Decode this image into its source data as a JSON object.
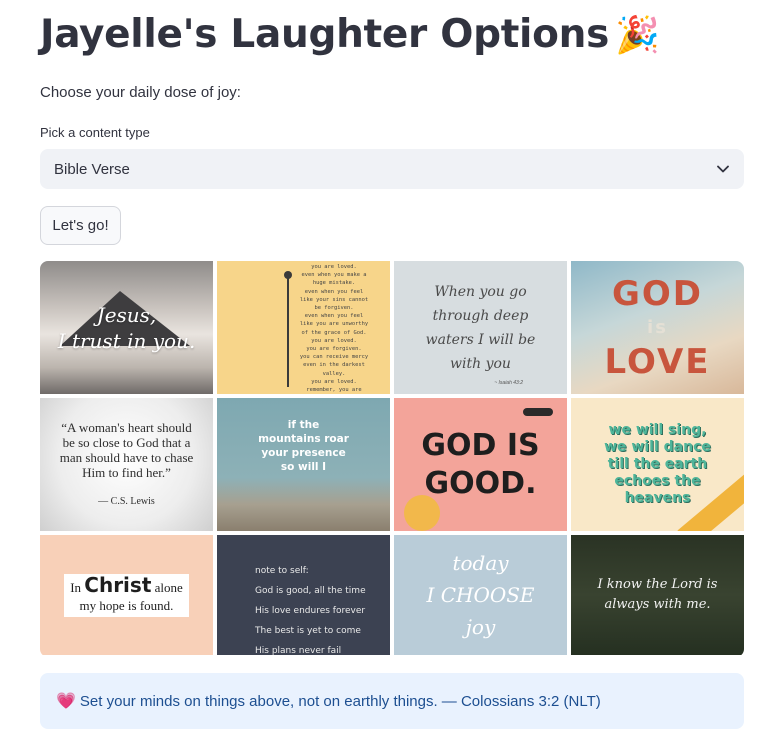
{
  "page": {
    "title": "Jayelle's Laughter Options",
    "title_emoji": "🎉",
    "subtitle": "Choose your daily dose of joy:"
  },
  "content_select": {
    "label": "Pick a content type",
    "value": "Bible Verse",
    "icon": "chevron-down-icon"
  },
  "go_button": {
    "label": "Let's go!"
  },
  "gallery": {
    "tiles": [
      {
        "text": "Jesus,\nI trust in you."
      },
      {
        "text": "you are loved.\neven when you make a\nhuge mistake.\neven when you feel\nlike your sins cannot\nbe forgiven.\neven when you feel\nlike you are unworthy\nof the grace of God.\nyou are loved.\nyou are forgiven.\nyou can receive mercy\neven in the darkest\nvalley.\nyou are loved.\nremember, you are\nlove. made from love.\nwith love."
      },
      {
        "text": "When you go\nthrough deep\nwaters I will be\nwith you",
        "ref": "~ Isaiah 43:2"
      },
      {
        "text": "GOD\nIS\nLOVE",
        "line1": "GOD",
        "line2": "is",
        "line3": "LOVE"
      },
      {
        "text": "“A woman's heart should\nbe so close to God that a\nman should have to chase\nHim to find her.”",
        "by": "— C.S. Lewis"
      },
      {
        "text": "if the\nmountains roar\nyour presence\nso will I"
      },
      {
        "text": "GOD IS\nGOOD."
      },
      {
        "text": "we will sing,\nwe will dance\ntill the earth\nechoes the\nheavens"
      },
      {
        "line1_pre": "In ",
        "line1_bold": "Christ",
        "line1_post": " alone",
        "line2": "my hope is found."
      },
      {
        "text": "note to self:\nGod is good, all the time\nHis love endures forever\nThe best is yet to come\nHis plans never fail"
      },
      {
        "text": "today\nI CHOOSE\njoy"
      },
      {
        "text": "I know the Lord is\nalways with me."
      }
    ]
  },
  "verse_alert": {
    "icon": "heart-icon",
    "emoji": "💗",
    "text": "Set your minds on things above, not on earthly things. — Colossians 3:2 (NLT)"
  }
}
